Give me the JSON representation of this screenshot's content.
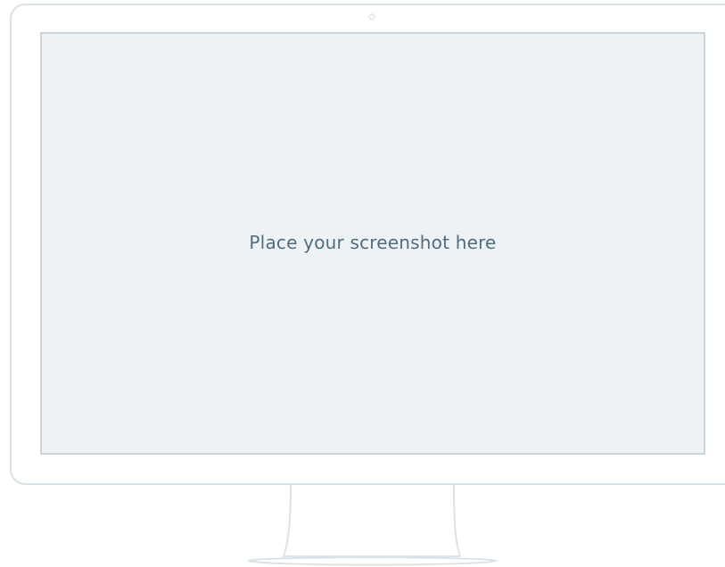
{
  "placeholder": {
    "label": "Place your screenshot here"
  },
  "colors": {
    "bezel_stroke": "#d7e1e6",
    "screen_fill": "#eff2f5",
    "screen_stroke": "#c8d5dc",
    "text": "#4f6d7f"
  },
  "icons": {
    "camera": "camera-icon"
  }
}
